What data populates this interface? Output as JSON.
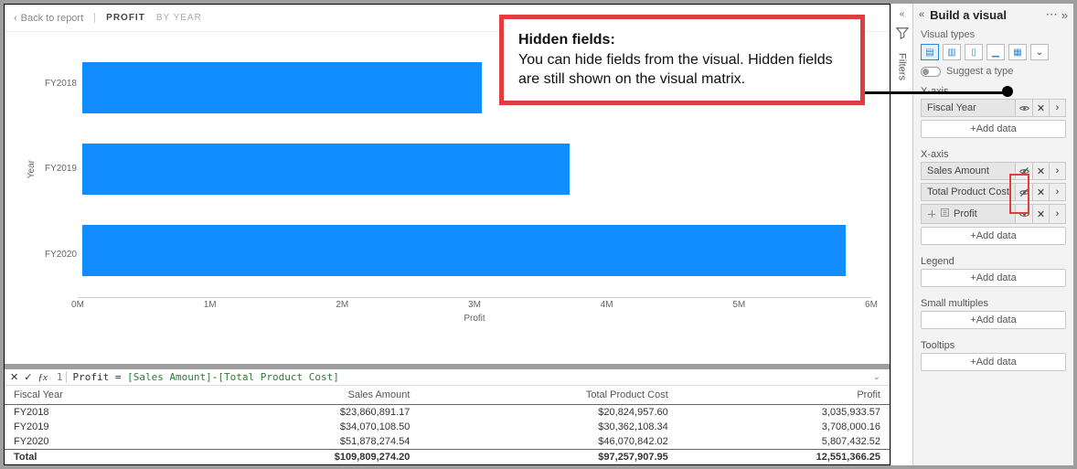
{
  "header": {
    "back_label": "Back to report",
    "crumb_active": "PROFIT",
    "crumb_dim": "BY YEAR"
  },
  "chart_data": {
    "type": "bar",
    "orientation": "horizontal",
    "categories": [
      "FY2018",
      "FY2019",
      "FY2020"
    ],
    "values": [
      3035933.57,
      3708000.16,
      5807432.52
    ],
    "title": "",
    "xlabel": "Profit",
    "ylabel": "Year",
    "xlim": [
      0,
      6000000
    ],
    "xticks": [
      "0M",
      "1M",
      "2M",
      "3M",
      "4M",
      "5M",
      "6M"
    ],
    "color": "#118dff"
  },
  "formula": {
    "line_no": "1",
    "measure": "Profit",
    "expr_prefix": " = ",
    "col1": "[Sales Amount]",
    "minus": "-",
    "col2": "[Total Product Cost]"
  },
  "table": {
    "columns": [
      "Fiscal Year",
      "Sales Amount",
      "Total Product Cost",
      "Profit"
    ],
    "rows": [
      [
        "FY2018",
        "$23,860,891.17",
        "$20,824,957.60",
        "3,035,933.57"
      ],
      [
        "FY2019",
        "$34,070,108.50",
        "$30,362,108.34",
        "3,708,000.16"
      ],
      [
        "FY2020",
        "$51,878,274.54",
        "$46,070,842.02",
        "5,807,432.52"
      ]
    ],
    "total_row": [
      "Total",
      "$109,809,274.20",
      "$97,257,907.95",
      "12,551,366.25"
    ]
  },
  "filters_label": "Filters",
  "panel": {
    "title": "Build a visual",
    "visual_types_label": "Visual types",
    "suggest_label": "Suggest a type",
    "wells": {
      "yaxis": {
        "title": "X-axis",
        "fields": [
          {
            "name": "Fiscal Year",
            "hidden": false,
            "measure": false
          }
        ],
        "add": "+Add data"
      },
      "xaxis": {
        "title": "X-axis",
        "fields": [
          {
            "name": "Sales Amount",
            "hidden": true,
            "measure": false
          },
          {
            "name": "Total Product Cost",
            "hidden": true,
            "measure": false
          },
          {
            "name": "Profit",
            "hidden": false,
            "measure": true
          }
        ],
        "add": "+Add data"
      },
      "legend": {
        "title": "Legend",
        "add": "+Add data"
      },
      "small": {
        "title": "Small multiples",
        "add": "+Add data"
      },
      "tooltips": {
        "title": "Tooltips",
        "add": "+Add data"
      }
    }
  },
  "callout": {
    "title": "Hidden fields:",
    "body": "You can hide fields from the visual. Hidden fields are still shown on the visual matrix."
  }
}
